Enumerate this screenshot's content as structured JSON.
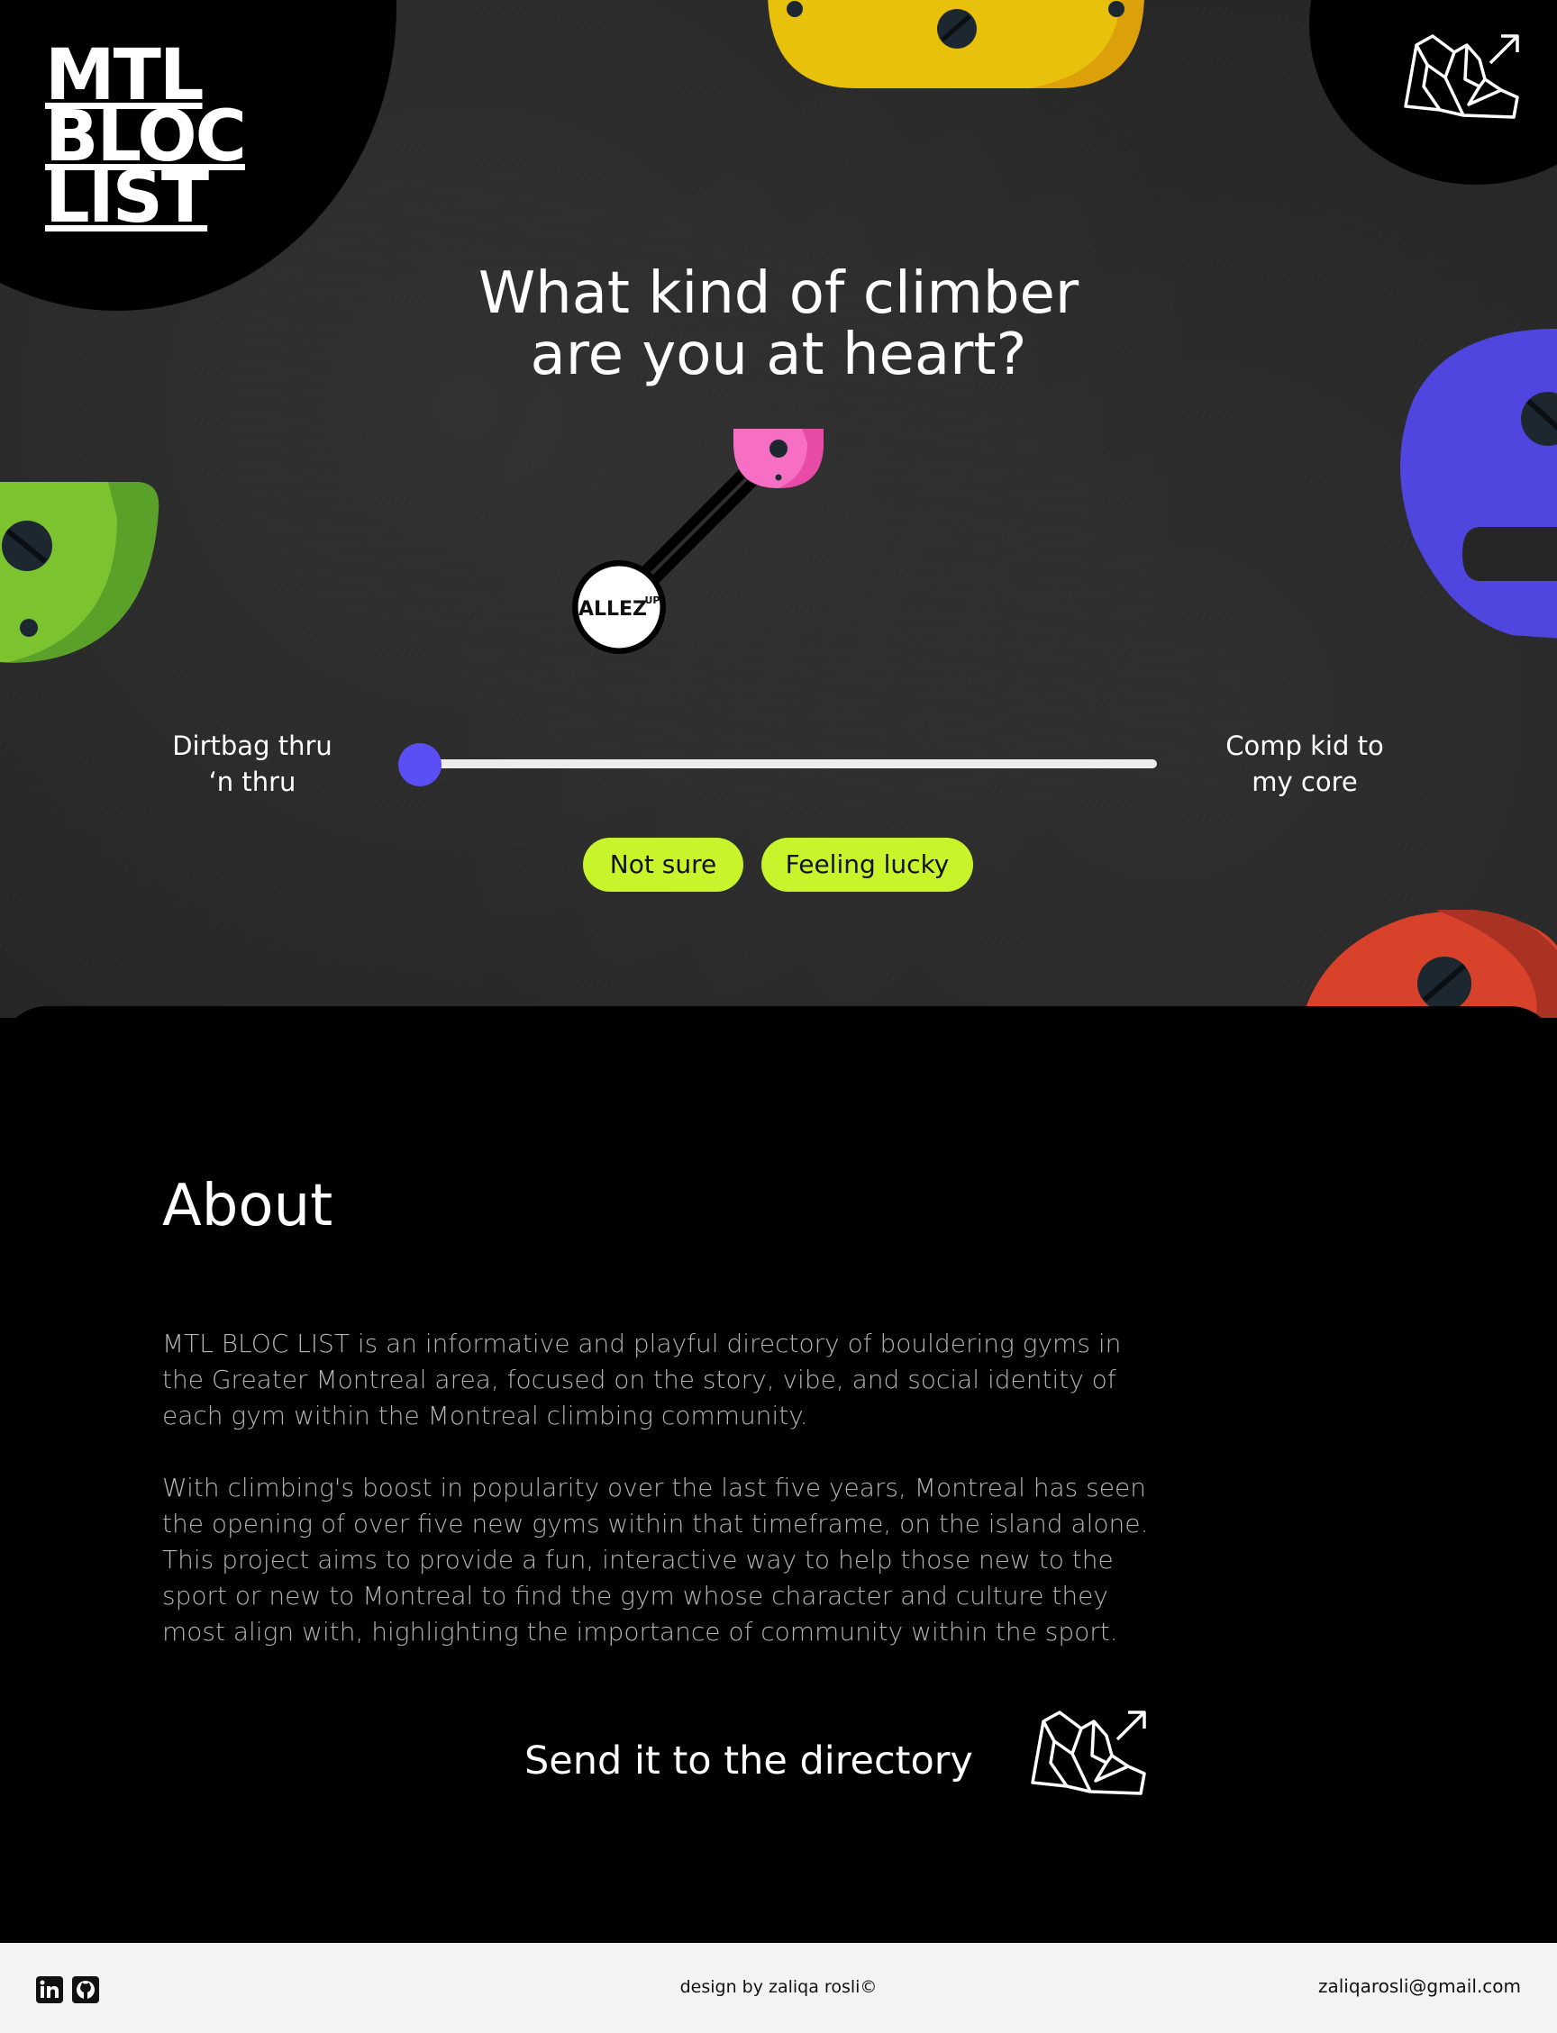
{
  "header": {
    "logo_lines": [
      "MTL",
      "BLOC",
      "LIST"
    ],
    "directory_link_icon": "boulder-arrow-icon"
  },
  "hero": {
    "title_line1": "What kind of climber",
    "title_line2": "are you at heart?",
    "gym_badge": "ALLEZ UP",
    "slider": {
      "left_label_line1": "Dirtbag thru",
      "left_label_line2": "‘n thru",
      "right_label_line1": "Comp kid to",
      "right_label_line2": "my core",
      "value": 0
    },
    "buttons": {
      "not_sure": "Not sure",
      "feeling_lucky": "Feeling lucky"
    }
  },
  "about": {
    "title": "About",
    "paragraph1": "MTL BLOC LIST is an informative and playful directory of bouldering gyms in the Greater Montreal area, focused on the story, vibe, and social identity of each gym within the Montreal climbing community.",
    "paragraph2": "With climbing's boost in popularity over the last five years, Montreal has seen the opening of over five new gyms within that timeframe, on the island alone. This project aims to provide a fun, interactive way to help those new to the sport or new to Montreal to find the gym whose character and culture they most align with, highlighting the importance of community within the sport.",
    "cta_label": "Send it to the directory"
  },
  "footer": {
    "credit": "design by zaliqa rosli©",
    "email": "zaliqarosli@gmail.com",
    "social_icons": [
      "linkedin-icon",
      "github-icon"
    ]
  },
  "colors": {
    "accent_lime": "#c8f42c",
    "slider_thumb": "#5a4ff5",
    "hold_yellow": "#e8c10c",
    "hold_green": "#7bc42f",
    "hold_blue": "#4f46e0",
    "hold_pink": "#f76fc4",
    "hold_red": "#d8412a"
  }
}
